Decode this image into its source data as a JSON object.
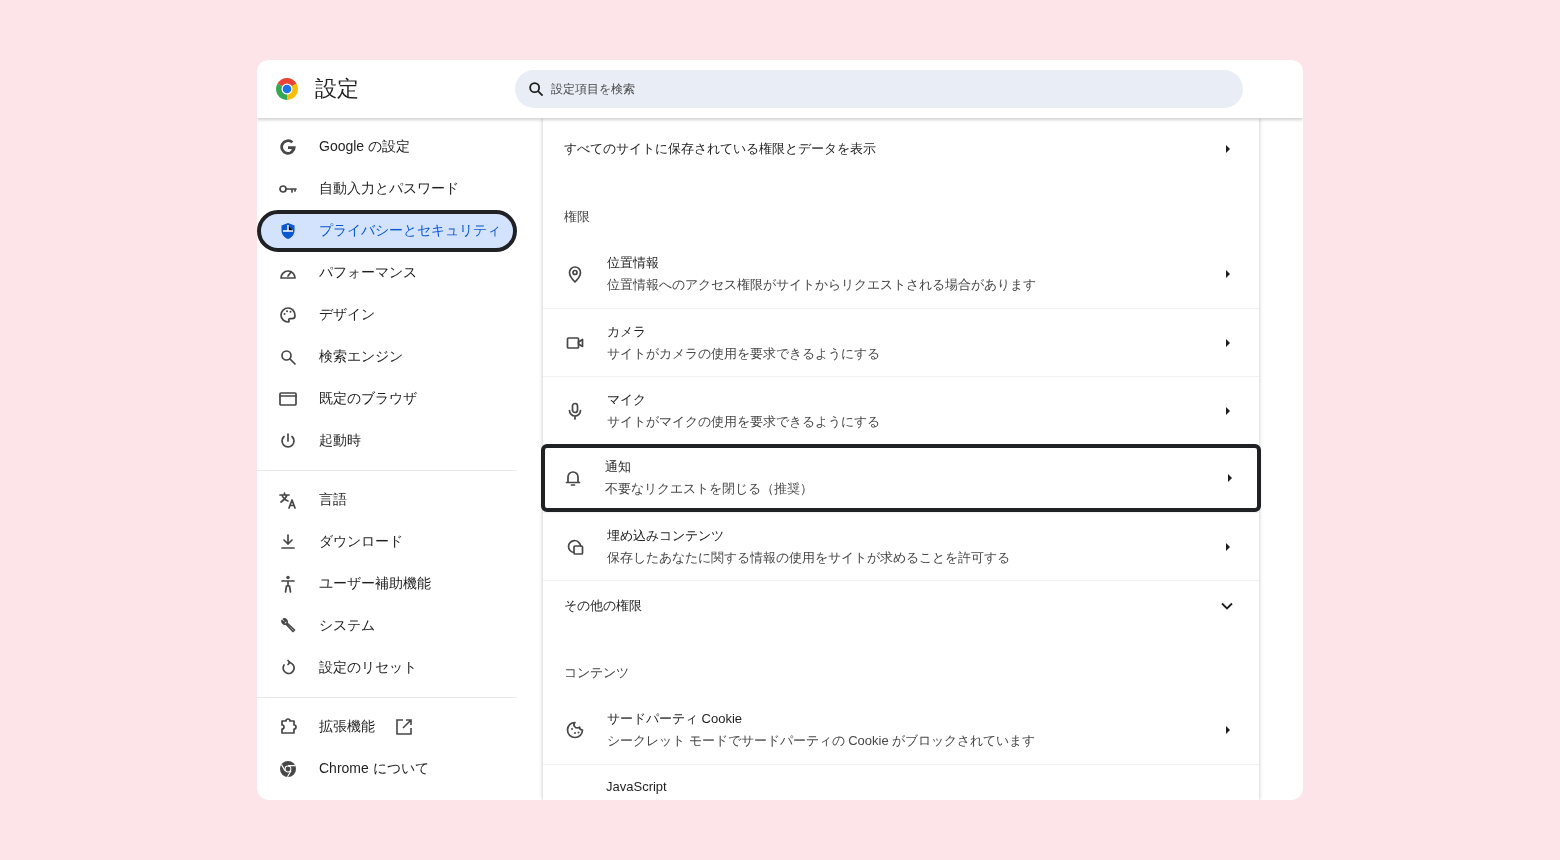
{
  "window": {
    "title": "設定"
  },
  "search": {
    "placeholder": "設定項目を検索"
  },
  "sidebar": {
    "groups": [
      {
        "items": [
          {
            "label": "Google の設定",
            "selected": false,
            "highlighted": false
          },
          {
            "label": "自動入力とパスワード",
            "selected": false,
            "highlighted": false
          },
          {
            "label": "プライバシーとセキュリティ",
            "selected": true,
            "highlighted": true
          },
          {
            "label": "パフォーマンス",
            "selected": false,
            "highlighted": false
          },
          {
            "label": "デザイン",
            "selected": false,
            "highlighted": false
          },
          {
            "label": "検索エンジン",
            "selected": false,
            "highlighted": false
          },
          {
            "label": "既定のブラウザ",
            "selected": false,
            "highlighted": false
          },
          {
            "label": "起動時",
            "selected": false,
            "highlighted": false
          }
        ]
      },
      {
        "items": [
          {
            "label": "言語",
            "selected": false,
            "highlighted": false
          },
          {
            "label": "ダウンロード",
            "selected": false,
            "highlighted": false
          },
          {
            "label": "ユーザー補助機能",
            "selected": false,
            "highlighted": false
          },
          {
            "label": "システム",
            "selected": false,
            "highlighted": false
          },
          {
            "label": "設定のリセット",
            "selected": false,
            "highlighted": false
          }
        ]
      },
      {
        "items": [
          {
            "label": "拡張機能",
            "selected": false,
            "highlighted": false,
            "external": true
          },
          {
            "label": "Chrome について",
            "selected": false,
            "highlighted": false
          }
        ]
      }
    ]
  },
  "content": {
    "rows": [
      {
        "kind": "link",
        "title": "すべてのサイトに保存されている権限とデータを表示"
      },
      {
        "kind": "heading",
        "title": "権限"
      },
      {
        "kind": "permission",
        "title": "位置情報",
        "subtitle": "位置情報へのアクセス権限がサイトからリクエストされる場合があります",
        "highlighted": false
      },
      {
        "kind": "permission",
        "title": "カメラ",
        "subtitle": "サイトがカメラの使用を要求できるようにする",
        "highlighted": false
      },
      {
        "kind": "permission",
        "title": "マイク",
        "subtitle": "サイトがマイクの使用を要求できるようにする",
        "highlighted": false
      },
      {
        "kind": "permission",
        "title": "通知",
        "subtitle": "不要なリクエストを閉じる（推奨）",
        "highlighted": true
      },
      {
        "kind": "permission",
        "title": "埋め込みコンテンツ",
        "subtitle": "保存したあなたに関する情報の使用をサイトが求めることを許可する",
        "highlighted": false
      },
      {
        "kind": "expander",
        "title": "その他の権限",
        "expanded": false
      },
      {
        "kind": "heading",
        "title": "コンテンツ"
      },
      {
        "kind": "permission",
        "title": "サードパーティ Cookie",
        "subtitle": "シークレット モードでサードパーティの Cookie がブロックされています",
        "highlighted": false
      },
      {
        "kind": "partial",
        "title": "JavaScript"
      }
    ]
  }
}
